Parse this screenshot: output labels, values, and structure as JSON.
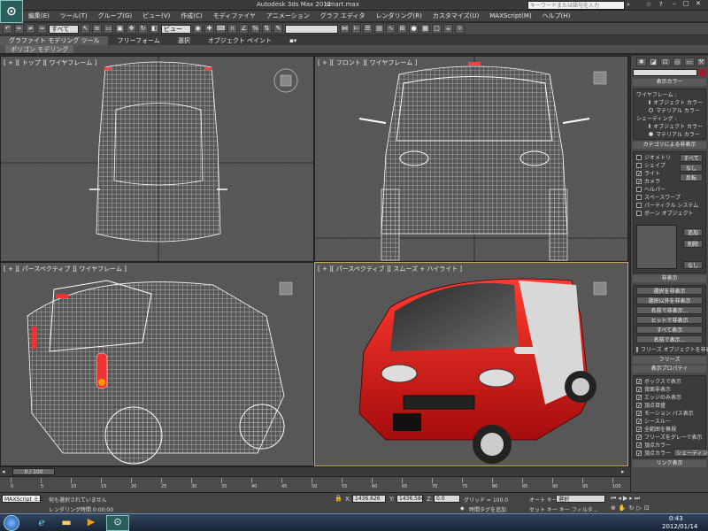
{
  "window": {
    "app_title": "Autodesk 3ds Max  2011",
    "file_name": "smart.max",
    "search_placeholder": "キーワードまたは語句を入力"
  },
  "menu": [
    "編集(E)",
    "ツール(T)",
    "グループ(G)",
    "ビュー(V)",
    "作成(C)",
    "モディファイヤ",
    "アニメーション",
    "グラフ エディタ",
    "レンダリング(R)",
    "カスタマイズ(U)",
    "MAXScript(M)",
    "ヘルプ(H)"
  ],
  "toolbar": {
    "selection_filter": "すべて",
    "coord_system": "ビュー"
  },
  "ribbon": {
    "tabs": [
      "グラファイト モデリング ツール",
      "フリーフォーム",
      "選択",
      "オブジェクト ペイント"
    ],
    "sub_tab": "ポリゴン モデリング"
  },
  "viewports": {
    "top": "[ + ][ トップ ][ ワイヤフレーム ]",
    "front": "[ + ][ フロント ][ ワイヤフレーム ]",
    "persp_wire": "[ + ][ パースペクティブ ][ ワイヤフレーム ]",
    "persp_shaded": "[ + ][ パースペクティブ ][ スムーズ + ハイライト ]"
  },
  "command_panel": {
    "display_color": {
      "title": "表示カラー",
      "wireframe_label": "ワイヤフレーム :",
      "wire_options": [
        "オブジェクト カラー",
        "マテリアル カラー"
      ],
      "shading_label": "シェーディング :",
      "shade_options": [
        "オブジェクト カラー",
        "マテリアル カラー"
      ]
    },
    "hide_by_category": {
      "title": "カテゴリによる非表示",
      "items": [
        {
          "label": "ジオメトリ",
          "checked": false
        },
        {
          "label": "シェイプ",
          "checked": false
        },
        {
          "label": "ライト",
          "checked": true
        },
        {
          "label": "カメラ",
          "checked": true
        },
        {
          "label": "ヘルパー",
          "checked": false
        },
        {
          "label": "スペースワープ",
          "checked": false
        },
        {
          "label": "パーティクル システム",
          "checked": false
        },
        {
          "label": "ボーン オブジェクト",
          "checked": false
        }
      ],
      "buttons": [
        "すべて",
        "なし",
        "反転"
      ],
      "list_buttons": [
        "追加",
        "削除",
        "なし"
      ]
    },
    "hide": {
      "title": "非表示",
      "buttons": [
        "選択を非表示",
        "選択以外を非表示",
        "名前で非表示...",
        "ヒットで非表示",
        "すべて表示",
        "名前で表示...",
        "フリーズ オブジェクトを非表示"
      ]
    },
    "freeze": {
      "title": "フリーズ"
    },
    "display_props": {
      "title": "表示プロパティ",
      "items": [
        {
          "label": "ボックスで表示",
          "checked": true
        },
        {
          "label": "背面非表示",
          "checked": true
        },
        {
          "label": "エッジのみ表示",
          "checked": true
        },
        {
          "label": "頂点目盛",
          "checked": true
        },
        {
          "label": "モーション パス表示",
          "checked": true
        },
        {
          "label": "シースルー",
          "checked": true
        },
        {
          "label": "全範囲を無視",
          "checked": true
        },
        {
          "label": "フリーズをグレーで表示",
          "checked": true
        },
        {
          "label": "頂点カラー",
          "checked": true
        },
        {
          "label": "頂点カラー",
          "checked": true
        }
      ],
      "shaded_button": "シェーディング"
    },
    "link_display": {
      "title": "リンク表示"
    }
  },
  "timeline": {
    "frame": "0 / 100",
    "ticks": [
      "0",
      "5",
      "10",
      "15",
      "20",
      "25",
      "30",
      "35",
      "40",
      "45",
      "50",
      "55",
      "60",
      "65",
      "70",
      "75",
      "80",
      "85",
      "90",
      "95",
      "100"
    ]
  },
  "status": {
    "maxscript": "MAXScript ミニ",
    "message": "何も選択されていません",
    "render_time": "レンダリング時間 0:00:00",
    "x_label": "X:",
    "x_value": "1436.626",
    "y_label": "Y:",
    "y_value": "1436.584",
    "z_label": "Z:",
    "z_value": "0.0",
    "grid": "グリッド = 100.0",
    "add_time_tag": "時間タグを追加",
    "auto_key": "オート キー",
    "set_key": "セット キー",
    "key_mode": "選択",
    "key_filter": "キー フィルタ..."
  },
  "taskbar": {
    "time": "0:43",
    "date": "2012/01/14"
  }
}
